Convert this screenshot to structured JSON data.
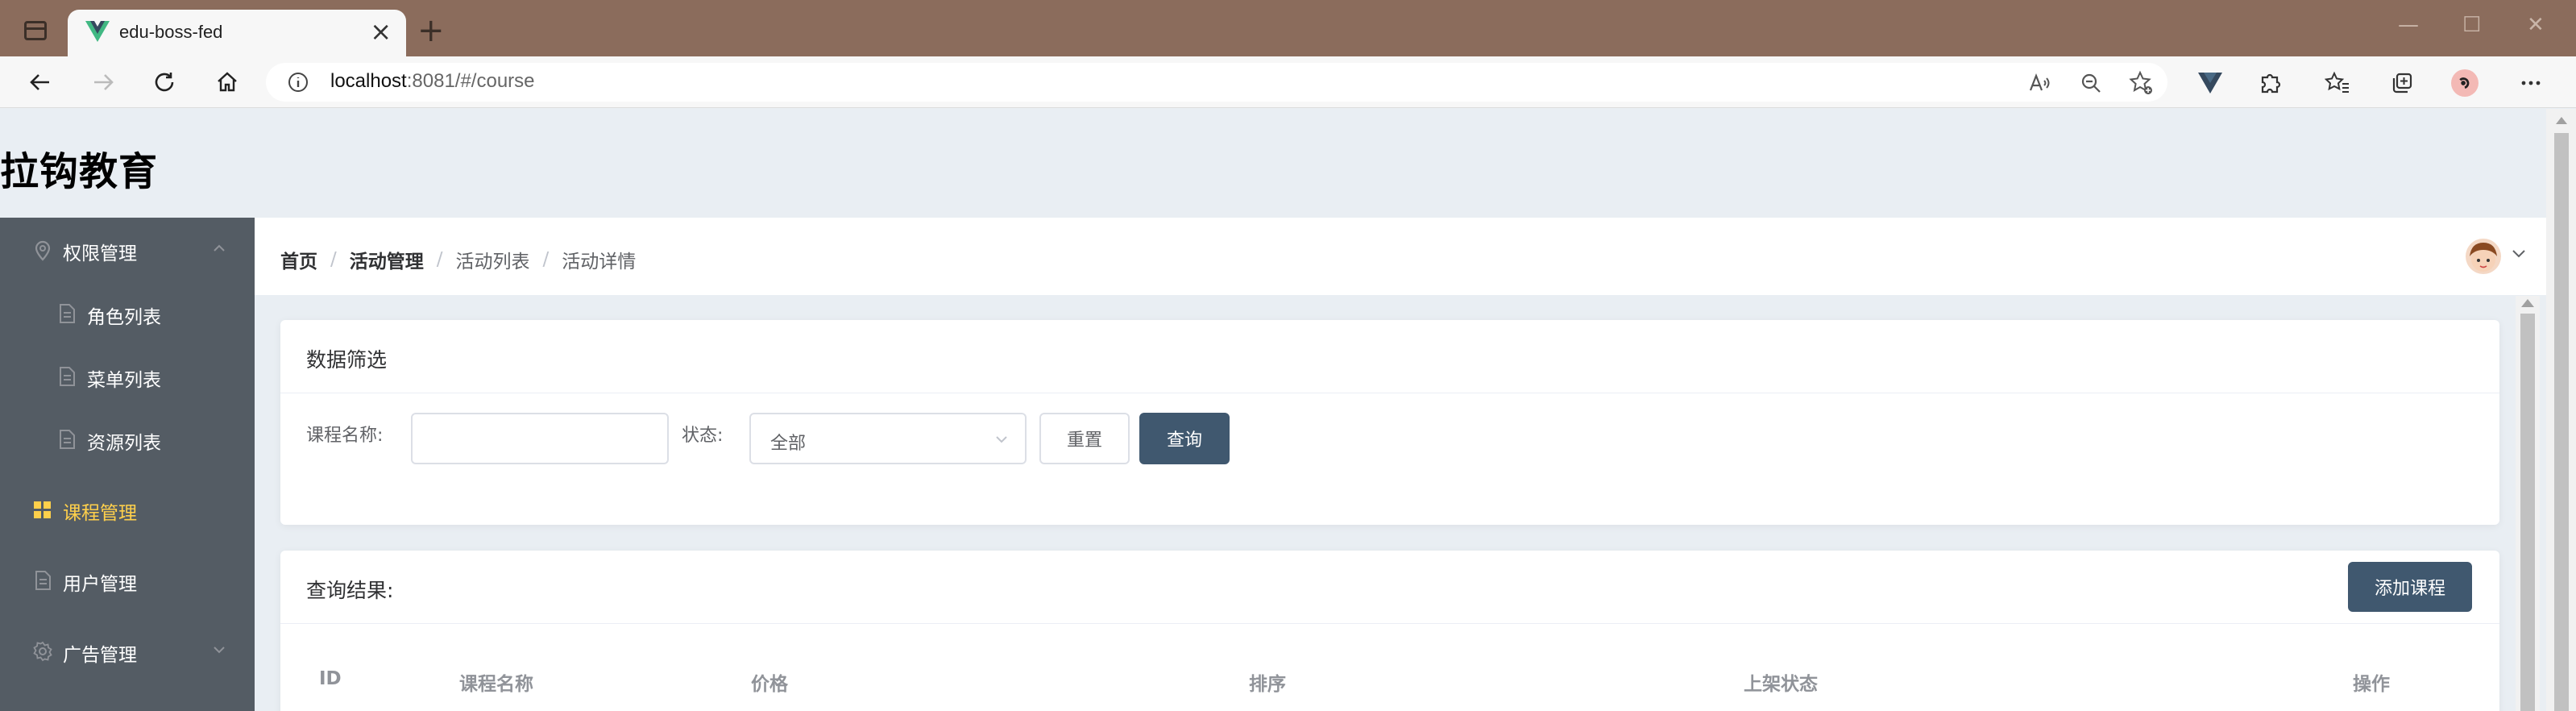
{
  "browser": {
    "tab_title": "edu-boss-fed",
    "url_host": "localhost",
    "url_path": ":8081/#/course",
    "new_tab_symbol": "+",
    "close_symbol": "×"
  },
  "app": {
    "logo": "拉钩教育"
  },
  "sidebar": {
    "items": [
      {
        "label": "权限管理",
        "icon": "location-icon",
        "expanded": true
      },
      {
        "label": "角色列表",
        "icon": "document-icon"
      },
      {
        "label": "菜单列表",
        "icon": "document-icon"
      },
      {
        "label": "资源列表",
        "icon": "document-icon"
      },
      {
        "label": "课程管理",
        "icon": "grid-icon",
        "active": true
      },
      {
        "label": "用户管理",
        "icon": "document-icon"
      },
      {
        "label": "广告管理",
        "icon": "gear-icon",
        "expanded": false
      }
    ],
    "colors": {
      "background": "#545c64",
      "text": "#ffffff",
      "active": "#ffd04b"
    }
  },
  "breadcrumb": {
    "items": [
      "首页",
      "活动管理",
      "活动列表",
      "活动详情"
    ],
    "separator": "/"
  },
  "filter": {
    "title": "数据筛选",
    "course_name_label": "课程名称:",
    "course_name_value": "",
    "status_label": "状态:",
    "status_value": "全部",
    "reset_label": "重置",
    "query_label": "查询"
  },
  "results": {
    "title": "查询结果:",
    "add_label": "添加课程",
    "columns": [
      "ID",
      "课程名称",
      "价格",
      "排序",
      "上架状态",
      "操作"
    ]
  },
  "theme": {
    "primary": "#40586f",
    "page_bg": "#e9eef3"
  }
}
